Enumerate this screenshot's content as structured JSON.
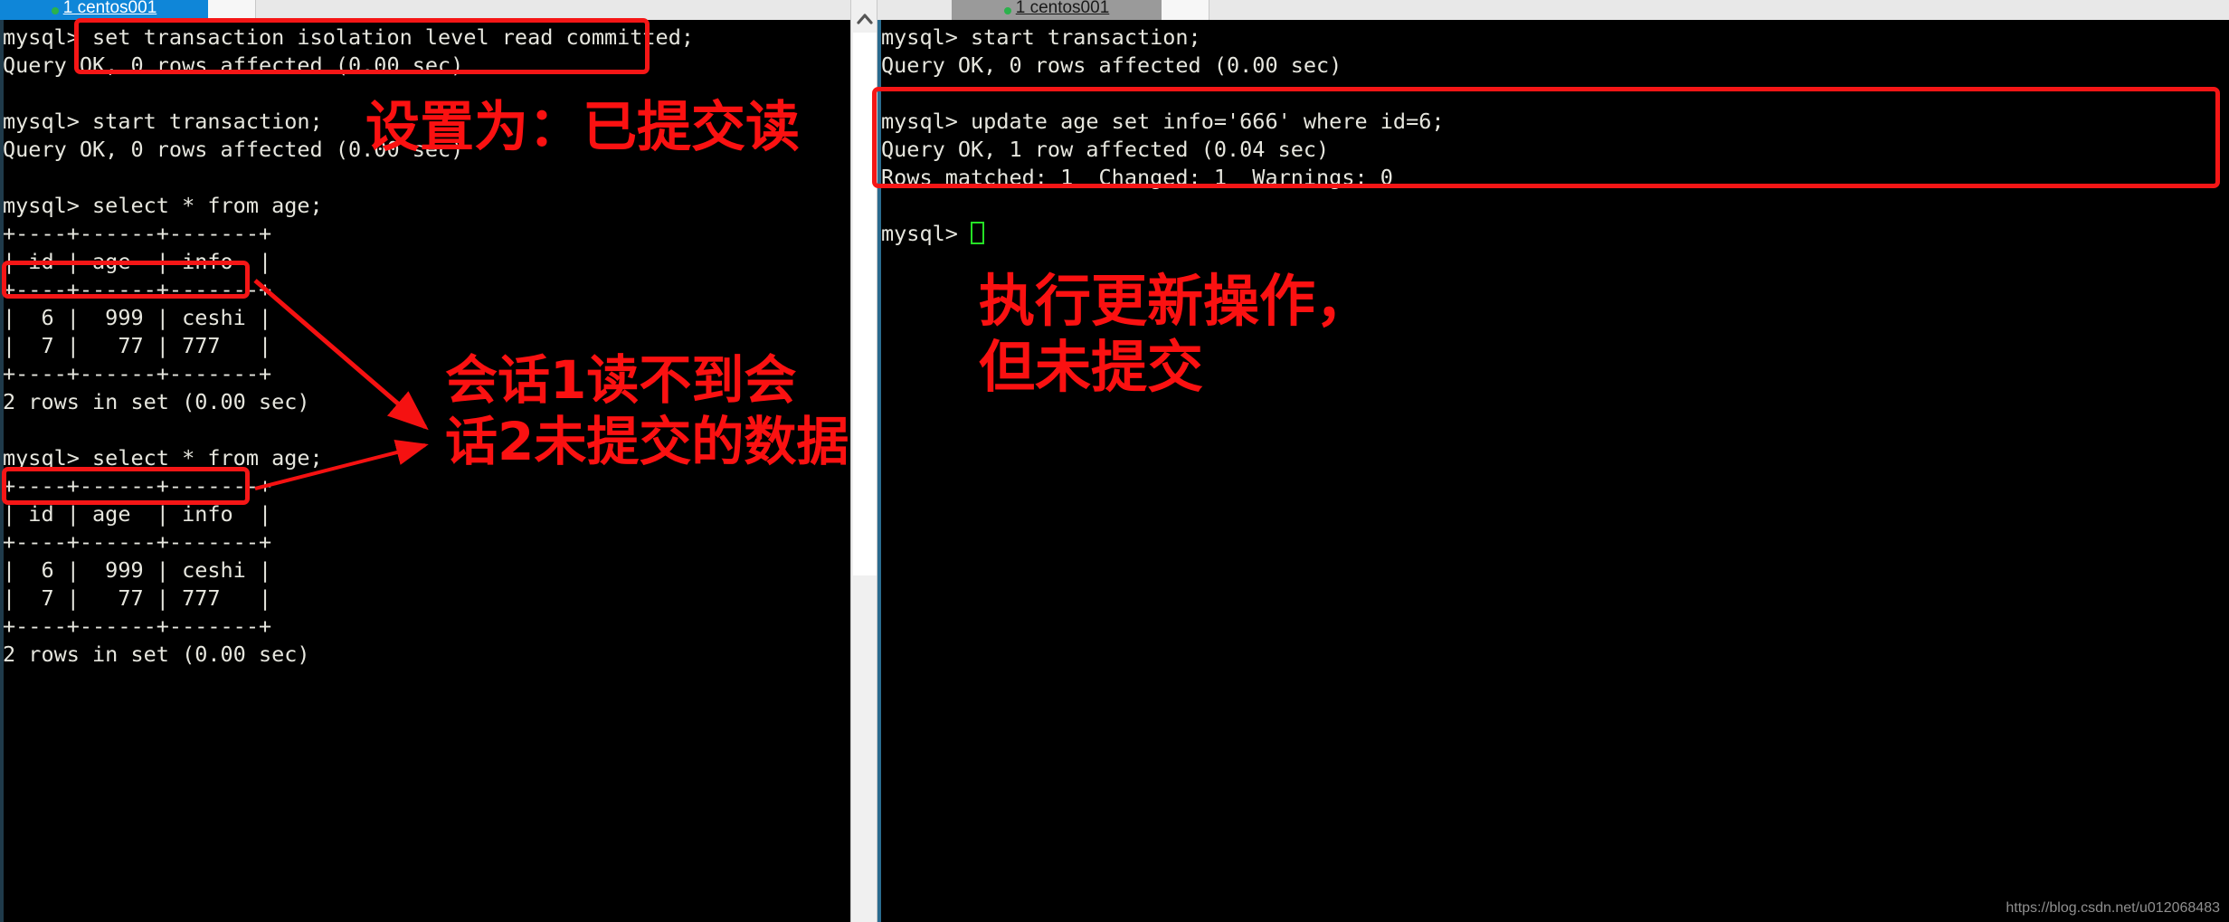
{
  "window": {
    "tabs": [
      {
        "label": "1 centos001",
        "number": "1",
        "name": "centos001",
        "state": "active",
        "color": "#0f86d8"
      },
      {
        "label": "1 centos001",
        "number": "1",
        "name": "centos001",
        "state": "inactive",
        "color": "#9a9a9a"
      }
    ]
  },
  "scrollbar": {
    "up_arrow_icon": "chevron-up-icon",
    "position": "near-top"
  },
  "left_terminal": {
    "title": "session-1-read-committed",
    "lines": [
      "mysql> set transaction isolation level read committed;",
      "Query OK, 0 rows affected (0.00 sec)",
      "",
      "mysql> start transaction;",
      "Query OK, 0 rows affected (0.00 sec)",
      "",
      "mysql> select * from age;",
      "+----+------+-------+",
      "| id | age  | info  |",
      "+----+------+-------+",
      "|  6 |  999 | ceshi |",
      "|  7 |   77 | 777   |",
      "+----+------+-------+",
      "2 rows in set (0.00 sec)",
      "",
      "mysql> select * from age;",
      "+----+------+-------+",
      "| id | age  | info  |",
      "+----+------+-------+",
      "|  6 |  999 | ceshi |",
      "|  7 |   77 | 777   |",
      "+----+------+-------+",
      "2 rows in set (0.00 sec)"
    ]
  },
  "right_terminal": {
    "title": "session-2-uncommitted-update",
    "lines": [
      "mysql> start transaction;",
      "Query OK, 0 rows affected (0.00 sec)",
      "",
      "mysql> update age set info='666' where id=6;",
      "Query OK, 1 row affected (0.04 sec)",
      "Rows matched: 1  Changed: 1  Warnings: 0",
      "",
      "mysql> "
    ],
    "prompt_cursor": "block-cursor"
  },
  "annotations": {
    "color": "#f51111",
    "notes": [
      {
        "id": "set-isolation",
        "text": "设置为：已提交读"
      },
      {
        "id": "session1-cannot-read",
        "text": "会话1读不到会\n话2未提交的数据"
      },
      {
        "id": "update-not-committed",
        "text": "执行更新操作，\n但未提交"
      }
    ],
    "boxes": [
      {
        "id": "box-set-transaction",
        "target": "set transaction isolation level read committed;"
      },
      {
        "id": "box-row6-first-select",
        "target": "|  6 |  999 | ceshi |"
      },
      {
        "id": "box-row6-second-select",
        "target": "|  6 |  999 | ceshi |"
      },
      {
        "id": "box-update-statement",
        "target": "mysql> update age set info='666' where id=6;"
      }
    ]
  },
  "watermark": {
    "text": "https://blog.csdn.net/u012068483"
  }
}
